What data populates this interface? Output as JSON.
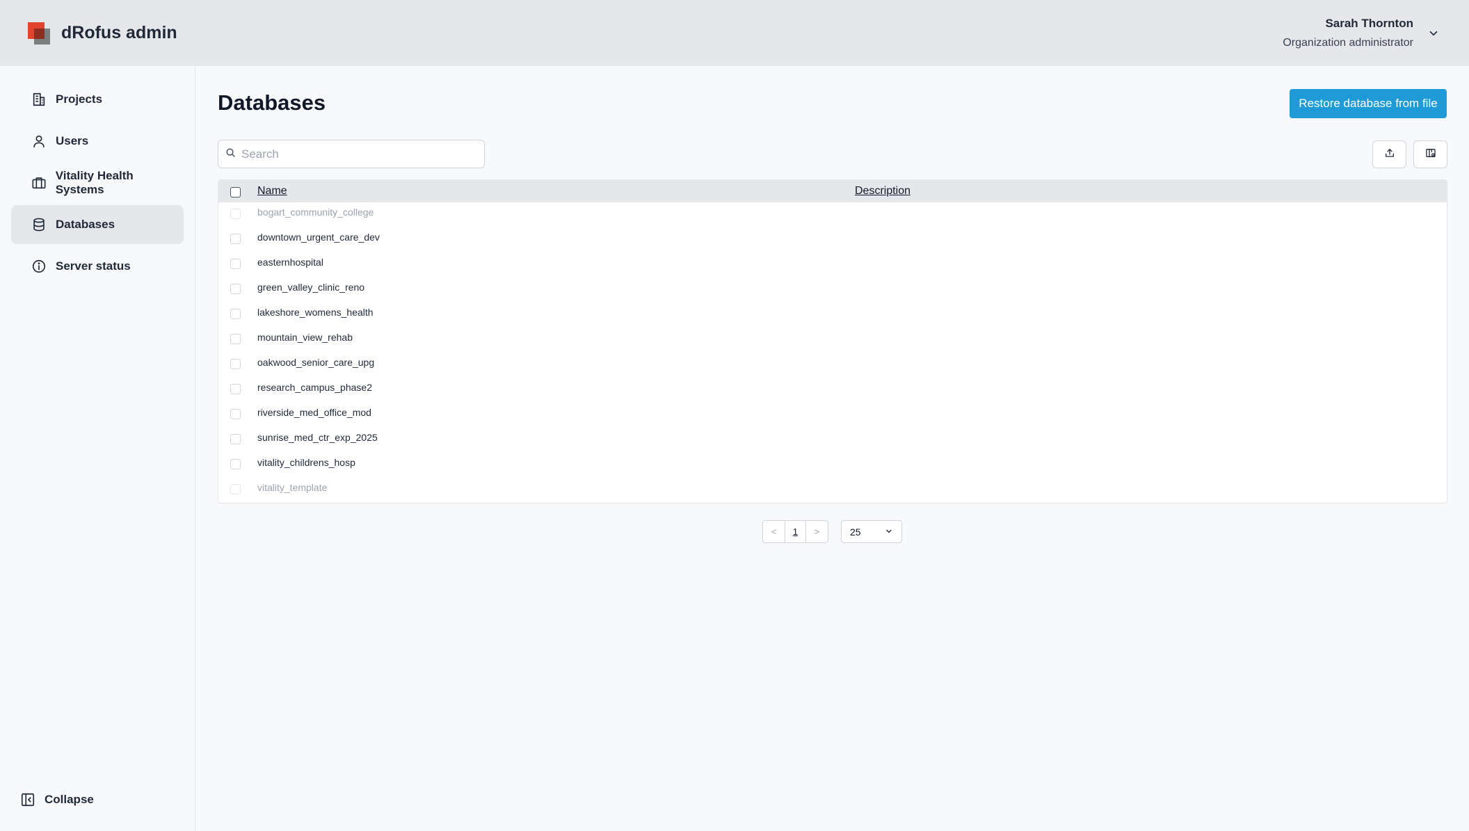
{
  "header": {
    "app_title": "dRofus admin",
    "user_name": "Sarah Thornton",
    "user_role": "Organization administrator"
  },
  "sidebar": {
    "items": [
      {
        "label": "Projects",
        "icon": "building-icon"
      },
      {
        "label": "Users",
        "icon": "user-icon"
      },
      {
        "label": "Vitality Health Systems",
        "icon": "briefcase-icon"
      },
      {
        "label": "Databases",
        "icon": "database-icon",
        "active": true
      },
      {
        "label": "Server status",
        "icon": "info-icon"
      }
    ],
    "collapse_label": "Collapse"
  },
  "main": {
    "title": "Databases",
    "restore_button": "Restore database from file",
    "search_placeholder": "Search",
    "table": {
      "columns": [
        "Name",
        "Description"
      ],
      "rows": [
        {
          "name": "bogart_community_college",
          "disabled": true
        },
        {
          "name": "downtown_urgent_care_dev",
          "disabled": false
        },
        {
          "name": "easternhospital",
          "disabled": false
        },
        {
          "name": "green_valley_clinic_reno",
          "disabled": false
        },
        {
          "name": "lakeshore_womens_health",
          "disabled": false
        },
        {
          "name": "mountain_view_rehab",
          "disabled": false
        },
        {
          "name": "oakwood_senior_care_upg",
          "disabled": false
        },
        {
          "name": "research_campus_phase2",
          "disabled": false
        },
        {
          "name": "riverside_med_office_mod",
          "disabled": false
        },
        {
          "name": "sunrise_med_ctr_exp_2025",
          "disabled": false
        },
        {
          "name": "vitality_childrens_hosp",
          "disabled": false
        },
        {
          "name": "vitality_template",
          "disabled": true
        }
      ]
    },
    "pagination": {
      "prev": "<",
      "page": "1",
      "next": ">",
      "per_page": "25"
    }
  },
  "colors": {
    "accent": "#1e9bd7",
    "header_bg": "#e5e7eb",
    "logo_red": "#e0432b"
  }
}
